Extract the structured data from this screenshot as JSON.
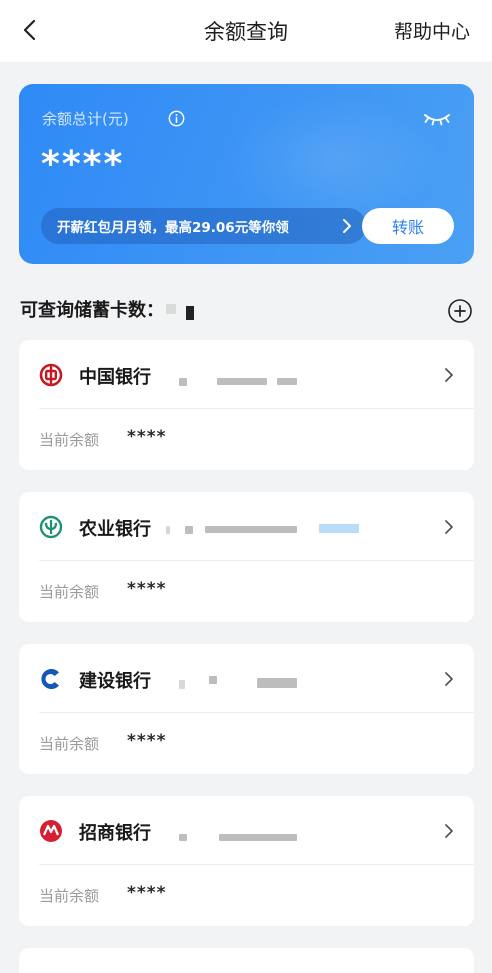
{
  "header": {
    "title": "余额查询",
    "help_label": "帮助中心"
  },
  "balance_card": {
    "label": "余额总计(元)",
    "value": "****",
    "promo_text": "开薪红包月月领，最高29.06元等你领",
    "transfer_label": "转账"
  },
  "section": {
    "title": "可查询储蓄卡数："
  },
  "banks": [
    {
      "name": "中国银行",
      "balance_label": "当前余额",
      "balance": "****",
      "logo_color": "#c41a23"
    },
    {
      "name": "农业银行",
      "balance_label": "当前余额",
      "balance": "****",
      "logo_color": "#1f9173"
    },
    {
      "name": "建设银行",
      "balance_label": "当前余额",
      "balance": "****",
      "logo_color": "#1457b6"
    },
    {
      "name": "招商银行",
      "balance_label": "当前余额",
      "balance": "****",
      "logo_color": "#d62031"
    }
  ],
  "colors": {
    "primary": "#2f7ff0",
    "card_gradient_start": "#2f8af6",
    "card_gradient_end": "#4aa0f3"
  }
}
